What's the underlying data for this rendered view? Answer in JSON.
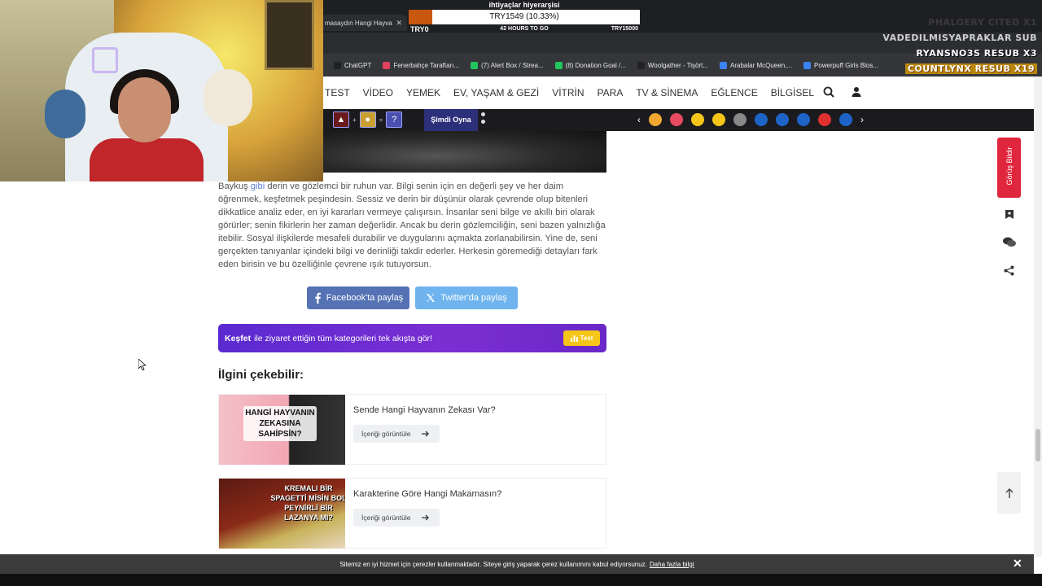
{
  "browser": {
    "active_tab_title": "masaydın Hangi Hayva",
    "tab_close": "✕",
    "bookmarks": [
      {
        "label": "ChatGPT",
        "color": "#202124"
      },
      {
        "label": "Fenerbahçe Taraftarı...",
        "color": "#e4405f"
      },
      {
        "label": "(7) Alert Box / Strea...",
        "color": "#22c55e"
      },
      {
        "label": "(8) Donation Goal /...",
        "color": "#22c55e"
      },
      {
        "label": "Woolgather - Tişört...",
        "color": "#222222"
      },
      {
        "label": "Arabalar McQueen,...",
        "color": "#3b82f6"
      },
      {
        "label": "Powerpuff Girls Blos...",
        "color": "#3b82f6"
      }
    ]
  },
  "stream_overlay": {
    "goal": {
      "title": "ihtiyaçlar hiyerarşisi",
      "progress_text": "TRY1549 (10.33%)",
      "progress": 0.1033,
      "low": "TRY0",
      "time_left": "42 HOURS TO GO",
      "high": "TRY15000"
    },
    "subs": [
      "PHALOERY CITED X1",
      "VADEDILMISYAPRAKLAR SUB",
      "RYANSNO3S RESUB X3",
      "COUNTLYNX RESUB X19"
    ]
  },
  "nav": {
    "items": [
      "TEST",
      "VİDEO",
      "YEMEK",
      "EV, YAŞAM & GEZİ",
      "VİTRİN",
      "PARA",
      "TV & SİNEMA",
      "EĞLENCE",
      "BİLGİSEL"
    ]
  },
  "game_band": {
    "plus": "+",
    "equals": "=",
    "question": "?",
    "play_label": "Şimdi Oyna",
    "prev": "‹",
    "next": "›",
    "emoji_colors": [
      "#f0a830",
      "#e84a5f",
      "#f5c518",
      "#f5c518",
      "#888888",
      "#1e64c8",
      "#1e64c8",
      "#1e64c8",
      "#e03030",
      "#1e64c8"
    ]
  },
  "article": {
    "lead": "Baykuş ",
    "link": "gibi",
    "body": " derin ve gözlemci bir ruhun var. Bilgi senin için en değerli şey ve her daim öğrenmek, keşfetmek peşindesin. Sessiz ve derin bir düşünür olarak çevrende olup bitenleri dikkatlice analiz eder, en iyi kararları vermeye çalışırsın. İnsanlar seni bilge ve akıllı biri olarak görürler; senin fikirlerin her zaman değerlidir. Ancak bu derin gözlemciliğin, seni bazen yalnızlığa itebilir. Sosyal ilişkilerde mesafeli durabilir ve duygularını açmakta zorlanabilirsin. Yine de, seni gerçekten tanıyanlar içindeki bilgi ve derinliği takdir ederler. Herkesin göremediği detayları fark eden birisin ve bu özelliğinle çevrene ışık tutuyorsun."
  },
  "share": {
    "facebook": "Facebook'ta paylaş",
    "twitter": "Twitter'da paylaş"
  },
  "kesfet": {
    "bold": "Keşfet",
    "text": "ile ziyaret ettiğin tüm kategorileri tek akışta gör!",
    "button": "Test"
  },
  "related": {
    "heading": "İlgini çekebilir:",
    "button_label": "İçeriği görüntüle",
    "cards": [
      {
        "title": "Sende Hangi Hayvanın Zekası Var?",
        "thumb_text": "HANGİ HAYVANIN ZEKASINA SAHİPSİN?"
      },
      {
        "title": "Karakterine Göre Hangi Makarnasın?",
        "thumb_text": "KREMALI BİR SPAGETTİ MİSİN BOL PEYNİRLİ BİR LAZANYA MI?"
      }
    ]
  },
  "sidebar": {
    "feedback": "Görüş Bildir"
  },
  "cookie": {
    "text": "Sitemiz en iyi hizmet için çerezler kullanmaktadır. Siteye giriş yaparak çerez kullanımını kabul ediyorsunuz.",
    "link": "Daha fazla bilgi",
    "close": "✕"
  }
}
